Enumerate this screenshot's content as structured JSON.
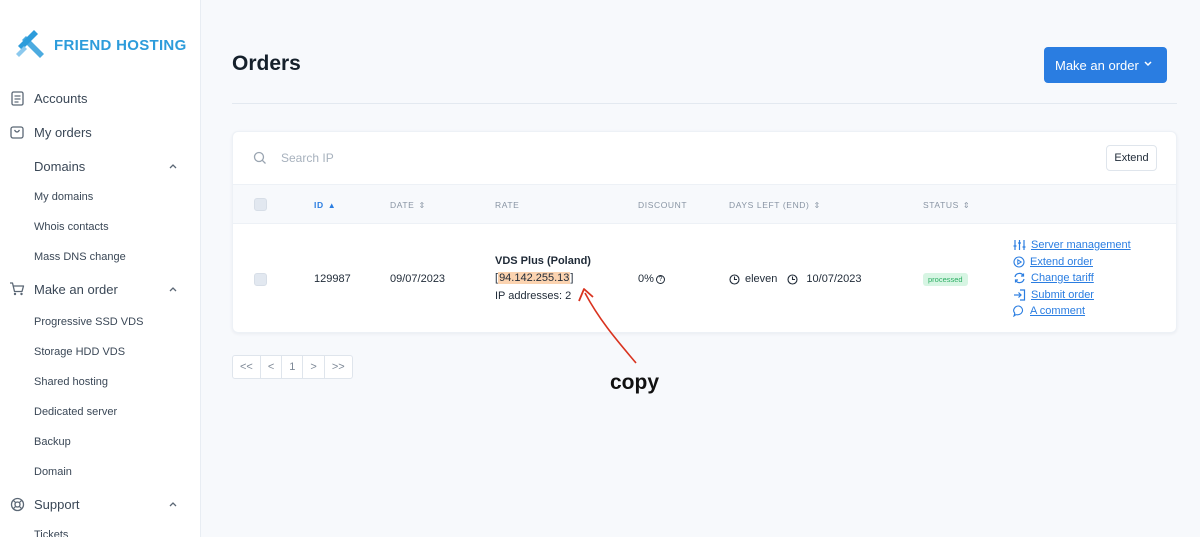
{
  "brand": {
    "name": "FRIEND HOSTING",
    "color": "#2d9cdb"
  },
  "sidebar": {
    "items": [
      {
        "label": "Accounts",
        "icon": "document-icon"
      },
      {
        "label": "My orders",
        "icon": "bag-icon"
      },
      {
        "label": "Domains",
        "icon": "none"
      },
      {
        "label": "Make an order",
        "icon": "cart-icon"
      },
      {
        "label": "Support",
        "icon": "lifebuoy-icon"
      }
    ],
    "domains_sub": [
      "My domains",
      "Whois contacts",
      "Mass DNS change"
    ],
    "order_sub": [
      "Progressive SSD VDS",
      "Storage HDD VDS",
      "Shared hosting",
      "Dedicated server",
      "Backup",
      "Domain"
    ],
    "support_sub": [
      "Tickets"
    ]
  },
  "header": {
    "title": "Orders",
    "make_order_label": "Make an order"
  },
  "search": {
    "placeholder": "Search IP"
  },
  "extend_label": "Extend",
  "table": {
    "columns": [
      "ID",
      "DATE",
      "RATE",
      "DISCOUNT",
      "DAYS LEFT (END)",
      "STATUS"
    ],
    "row": {
      "id": "129987",
      "date": "09/07/2023",
      "rate_name": "VDS Plus (Poland)",
      "ip_open": "[",
      "ip": "94.142.255.13",
      "ip_close": "]",
      "ip_count": "IP addresses: 2",
      "discount": "0%",
      "days_left": "eleven",
      "end_date": "10/07/2023",
      "status": "processed",
      "actions": [
        "Server management",
        "Extend order",
        "Change tariff",
        "Submit order",
        "A comment"
      ]
    }
  },
  "pagination": [
    "<<",
    "<",
    "1",
    ">",
    ">>"
  ],
  "annotation": "copy",
  "colors": {
    "accent": "#2a7de1",
    "status_bg": "#d7f5e3",
    "status_fg": "#2dae64",
    "highlight": "#fbd3b0",
    "arrow": "#d9331f"
  }
}
